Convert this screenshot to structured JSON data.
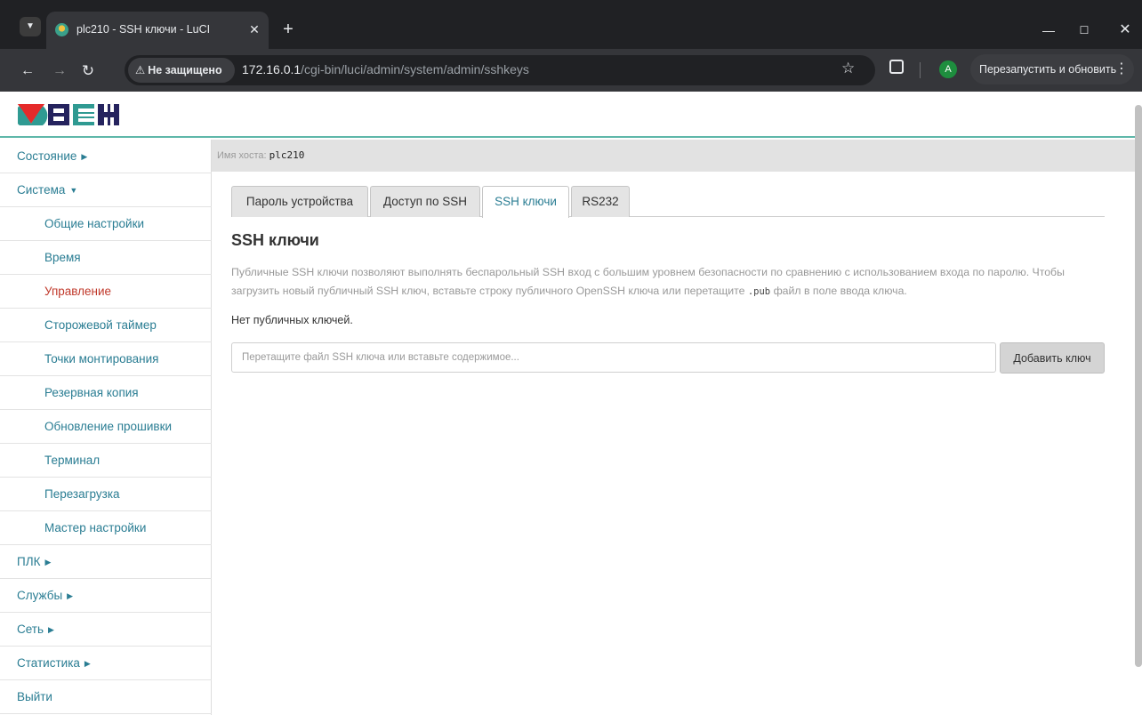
{
  "browser": {
    "tab_title": "plc210 - SSH ключи - LuCI",
    "tab_close": "✕",
    "new_tab": "+",
    "security_label": "Не защищено",
    "url_host": "172.16.0.1",
    "url_path": "/cgi-bin/luci/admin/system/admin/sshkeys",
    "profile_initial": "A",
    "relaunch_label": "Перезапустить и обновить",
    "icons": [
      "tab-search-icon",
      "favicon-icon",
      "close-icon",
      "plus-icon",
      "minimize-icon",
      "maximize-icon",
      "window-close-icon",
      "back-icon",
      "forward-icon",
      "reload-icon",
      "warning-icon",
      "star-icon",
      "extensions-icon",
      "more-icon"
    ]
  },
  "logo": {
    "colors": {
      "red": "#e52a2a",
      "teal": "#2f9a92",
      "navy": "#25235e"
    }
  },
  "sidebar": {
    "items": [
      {
        "label": "Состояние",
        "level": "top",
        "arrow": "▶"
      },
      {
        "label": "Система",
        "level": "top",
        "arrow": "▼"
      },
      {
        "label": "Общие настройки",
        "level": "sub"
      },
      {
        "label": "Время",
        "level": "sub"
      },
      {
        "label": "Управление",
        "level": "sub",
        "active": true
      },
      {
        "label": "Сторожевой таймер",
        "level": "sub"
      },
      {
        "label": "Точки монтирования",
        "level": "sub"
      },
      {
        "label": "Резервная копия",
        "level": "sub"
      },
      {
        "label": "Обновление прошивки",
        "level": "sub"
      },
      {
        "label": "Терминал",
        "level": "sub"
      },
      {
        "label": "Перезагрузка",
        "level": "sub"
      },
      {
        "label": "Мастер настройки",
        "level": "sub"
      },
      {
        "label": "ПЛК",
        "level": "top",
        "arrow": "▶"
      },
      {
        "label": "Службы",
        "level": "top",
        "arrow": "▶"
      },
      {
        "label": "Сеть",
        "level": "top",
        "arrow": "▶"
      },
      {
        "label": "Статистика",
        "level": "top",
        "arrow": "▶"
      },
      {
        "label": "Выйти",
        "level": "top"
      }
    ]
  },
  "host": {
    "label": "Имя хоста:",
    "name": "plc210"
  },
  "tabs": [
    {
      "label": "Пароль устройства"
    },
    {
      "label": "Доступ по SSH"
    },
    {
      "label": "SSH ключи",
      "current": true
    },
    {
      "label": "RS232"
    }
  ],
  "section": {
    "title": "SSH ключи",
    "description_1": "Публичные SSH ключи позволяют выполнять беспарольный SSH вход с большим уровнем безопасности по сравнению с использованием входа по паролю. Чтобы загрузить новый публичный SSH ключ, вставьте строку публичного OpenSSH ключа или перетащите",
    "description_code": ".pub",
    "description_2": "файл в поле ввода ключа.",
    "no_keys": "Нет публичных ключей.",
    "input_placeholder": "Перетащите файл SSH ключа или вставьте содержимое...",
    "input_value": "",
    "add_button": "Добавить ключ"
  },
  "colors": {
    "accent": "#2a7d93",
    "active": "#c0392b",
    "header_line": "#5fb7a9"
  }
}
